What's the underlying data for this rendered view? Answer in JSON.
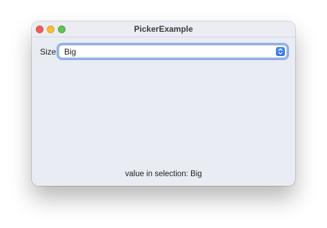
{
  "window": {
    "title": "PickerExample"
  },
  "picker": {
    "label": "Size",
    "selected": "Big"
  },
  "status": {
    "text": "value in selection: Big"
  },
  "colors": {
    "accent": "#2a6fe6",
    "focus_ring": "#8fb0ef",
    "close": "#ee5f58",
    "minimize": "#f6bd3a",
    "zoom": "#5fc454"
  },
  "icons": {
    "stepper": "chevron-up-down-icon"
  }
}
